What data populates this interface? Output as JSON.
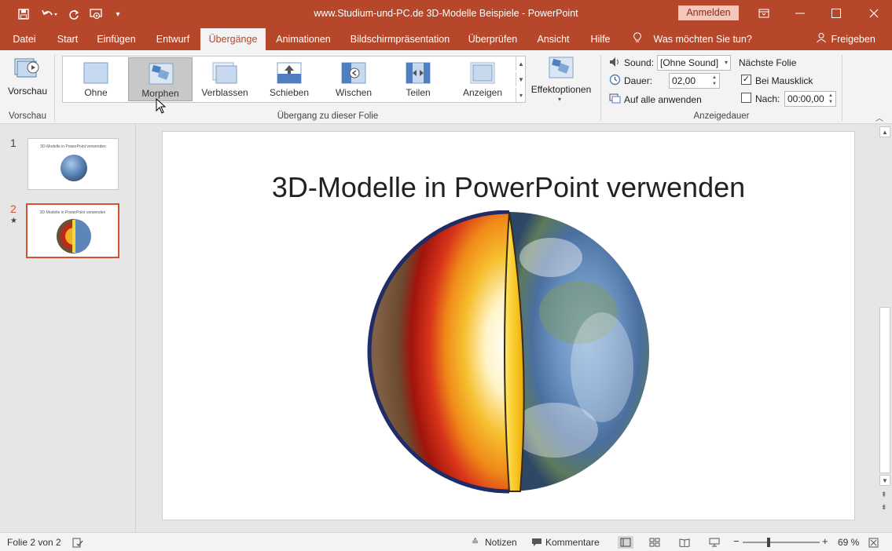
{
  "window": {
    "title": "www.Studium-und-PC.de  3D-Modelle Beispiele  -  PowerPoint",
    "signin_label": "Anmelden"
  },
  "tabs": [
    {
      "label": "Datei"
    },
    {
      "label": "Start"
    },
    {
      "label": "Einfügen"
    },
    {
      "label": "Entwurf"
    },
    {
      "label": "Übergänge"
    },
    {
      "label": "Animationen"
    },
    {
      "label": "Bildschirmpräsentation"
    },
    {
      "label": "Überprüfen"
    },
    {
      "label": "Ansicht"
    },
    {
      "label": "Hilfe"
    }
  ],
  "tell_me": "Was möchten Sie tun?",
  "share": "Freigeben",
  "ribbon": {
    "preview": {
      "label": "Vorschau",
      "group": "Vorschau"
    },
    "transitions": [
      {
        "label": "Ohne"
      },
      {
        "label": "Morphen"
      },
      {
        "label": "Verblassen"
      },
      {
        "label": "Schieben"
      },
      {
        "label": "Wischen"
      },
      {
        "label": "Teilen"
      },
      {
        "label": "Anzeigen"
      }
    ],
    "effect_options": "Effektoptionen",
    "transition_group": "Übergang zu dieser Folie",
    "timing": {
      "sound_label": "Sound:",
      "sound_value": "[Ohne Sound]",
      "duration_label": "Dauer:",
      "duration_value": "02,00",
      "apply_all": "Auf alle anwenden",
      "next_slide": "Nächste Folie",
      "on_click": "Bei Mausklick",
      "on_click_checked": true,
      "after_label": "Nach:",
      "after_value": "00:00,00",
      "after_checked": false,
      "group": "Anzeigedauer"
    }
  },
  "slides": [
    {
      "number": "1",
      "title": "3D-Modelle in PowerPoint verwenden"
    },
    {
      "number": "2",
      "title": "3D-Modelle in PowerPoint verwenden",
      "marker": "★"
    }
  ],
  "current_slide": {
    "title": "3D-Modelle in PowerPoint verwenden"
  },
  "status": {
    "slide_info": "Folie 2 von 2",
    "notes": "Notizen",
    "comments": "Kommentare",
    "zoom": "69 %"
  },
  "colors": {
    "accent": "#b7472a",
    "ribbon_bg": "#f3f3f3",
    "selected_thumb_border": "#d35230"
  }
}
